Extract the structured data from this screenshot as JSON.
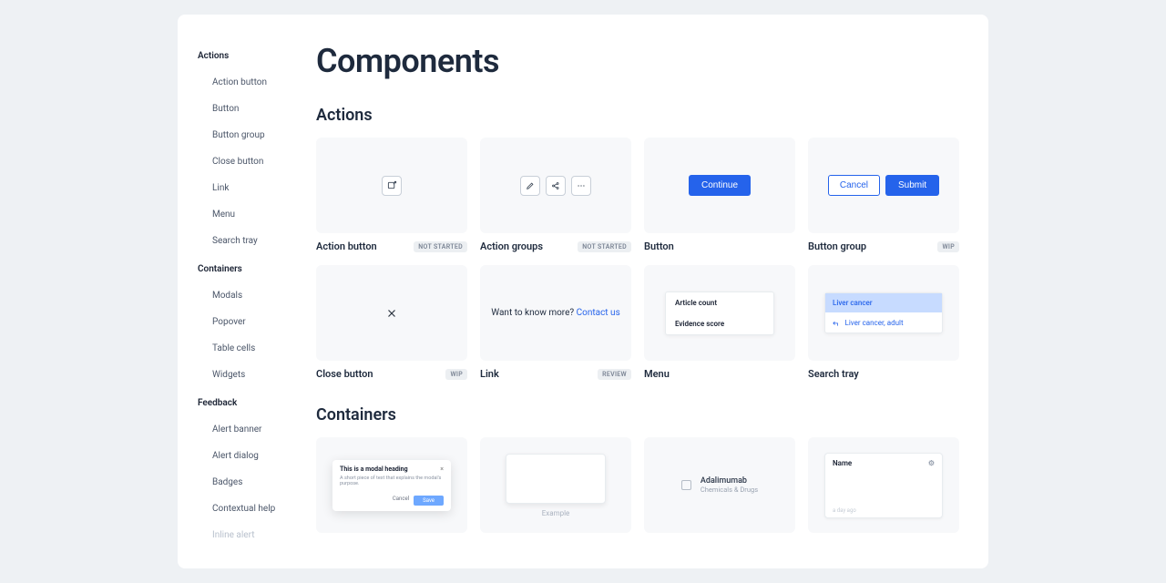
{
  "page": {
    "title": "Components"
  },
  "sidebar": {
    "groups": [
      {
        "heading": "Actions",
        "items": [
          "Action button",
          "Button",
          "Button group",
          "Close button",
          "Link",
          "Menu",
          "Search tray"
        ]
      },
      {
        "heading": "Containers",
        "items": [
          "Modals",
          "Popover",
          "Table cells",
          "Widgets"
        ]
      },
      {
        "heading": "Feedback",
        "items": [
          "Alert banner",
          "Alert dialog",
          "Badges",
          "Contextual help",
          "Inline alert"
        ]
      }
    ]
  },
  "badges": {
    "not_started": "NOT STARTED",
    "wip": "WIP",
    "review": "REVIEW"
  },
  "sections": {
    "actions": {
      "title": "Actions",
      "cards": {
        "action_button": {
          "title": "Action button",
          "badge": "not_started"
        },
        "action_groups": {
          "title": "Action groups",
          "badge": "not_started"
        },
        "button": {
          "title": "Button",
          "primary_label": "Continue"
        },
        "button_group": {
          "title": "Button group",
          "badge": "wip",
          "cancel": "Cancel",
          "submit": "Submit"
        },
        "close_button": {
          "title": "Close button",
          "badge": "wip"
        },
        "link": {
          "title": "Link",
          "badge": "review",
          "text": "Want to know more? ",
          "link_text": "Contact us"
        },
        "menu": {
          "title": "Menu",
          "items": [
            "Article count",
            "Evidence score"
          ]
        },
        "search_tray": {
          "title": "Search tray",
          "selected": "Liver cancer",
          "suggestion": "Liver cancer, adult"
        }
      }
    },
    "containers": {
      "title": "Containers",
      "cards": {
        "modals": {
          "heading": "This is a modal heading",
          "body": "A short piece of text that explains the modal's purpose.",
          "cancel": "Cancel",
          "primary": "Save"
        },
        "popover": {
          "caption": "Example"
        },
        "table_cells": {
          "title": "Adalimumab",
          "subtitle": "Chemicals & Drugs"
        },
        "widgets": {
          "header": "Name",
          "footer": "a day ago"
        }
      }
    }
  }
}
